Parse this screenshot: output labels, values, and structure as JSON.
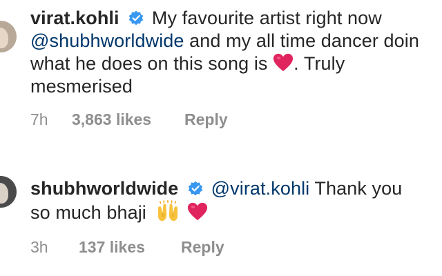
{
  "comments": [
    {
      "username": "virat.kohli",
      "verified": true,
      "text_line1": "My favourite artist right now",
      "mention": "@shubhworldwide",
      "text_line2_rest": " and my all time dancer doin",
      "text_line3": "what he does on this song is",
      "text_line3_end": ". Truly",
      "text_line4": "mesmerised",
      "emoji": [
        "red-heart"
      ],
      "time": "7h",
      "likes": "3,863 likes",
      "reply_label": "Reply"
    },
    {
      "username": "shubhworldwide",
      "verified": true,
      "mention": "@virat.kohli",
      "text_line1_rest": " Thank you",
      "text_line2": "so much bhaji",
      "emoji": [
        "raising-hands",
        "red-heart"
      ],
      "time": "3h",
      "likes": "137 likes",
      "reply_label": "Reply"
    }
  ],
  "colors": {
    "text": "#262626",
    "mention": "#00376b",
    "meta": "#8e8e8e",
    "verified_badge": "#3897f0",
    "heart": "#e0245e"
  }
}
